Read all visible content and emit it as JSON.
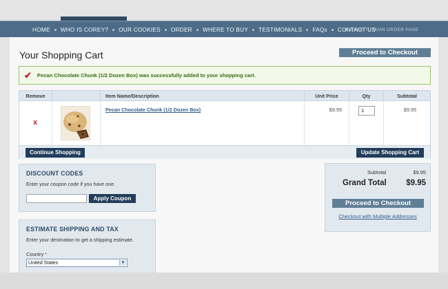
{
  "nav": {
    "items": [
      "HOME",
      "WHO IS COREY?",
      "OUR COOKIES",
      "ORDER",
      "WHERE TO BUY",
      "TESTIMONIALS",
      "FAQs",
      "CONTACT US"
    ],
    "back_link": "BACK TO MAIN ORDER PAGE"
  },
  "page": {
    "title": "Your Shopping Cart",
    "proceed_top": "Proceed to Checkout"
  },
  "message": {
    "success": "Pecan Chocolate Chunk (1/2 Dozen Box) was successfully added to your shopping cart."
  },
  "cart": {
    "headers": {
      "remove": "Remove",
      "item": "Item Name/Description",
      "unit_price": "Unit Price",
      "qty": "Qty",
      "subtotal": "Subtotal"
    },
    "rows": [
      {
        "remove": "x",
        "name": "Pecan Chocolate Chunk (1/2 Dozen Box)",
        "unit_price": "$9.95",
        "qty": "1",
        "subtotal": "$9.95"
      }
    ],
    "continue_label": "Continue Shopping",
    "update_label": "Update Shopping Cart"
  },
  "discount": {
    "heading": "DISCOUNT CODES",
    "text": "Enter your coupon code if you have one.",
    "coupon_value": "",
    "apply_label": "Apply Coupon"
  },
  "shipping": {
    "heading": "ESTIMATE SHIPPING AND TAX",
    "text": "Enter your destination to get a shipping estimate.",
    "country_label": "Country",
    "country_required": "*",
    "country_value": "United States"
  },
  "totals": {
    "subtotal_label": "Subtotal",
    "subtotal_value": "$9.95",
    "grand_total_label": "Grand Total",
    "grand_total_value": "$9.95",
    "checkout_label": "Proceed to Checkout",
    "multi_label": "Checkout with Multiple Addresses"
  },
  "colors": {
    "nav_bg": "#4c6c88",
    "button_dark": "#223d5b",
    "button_light": "#5f7f96",
    "remove_red": "#c0262a",
    "link_blue": "#2f5d8f",
    "success_green": "#3a6a12"
  },
  "icons": {
    "success": "check-icon",
    "remove": "remove-x-icon",
    "back": "back-arrow-icon",
    "select": "chevron-down-icon"
  }
}
